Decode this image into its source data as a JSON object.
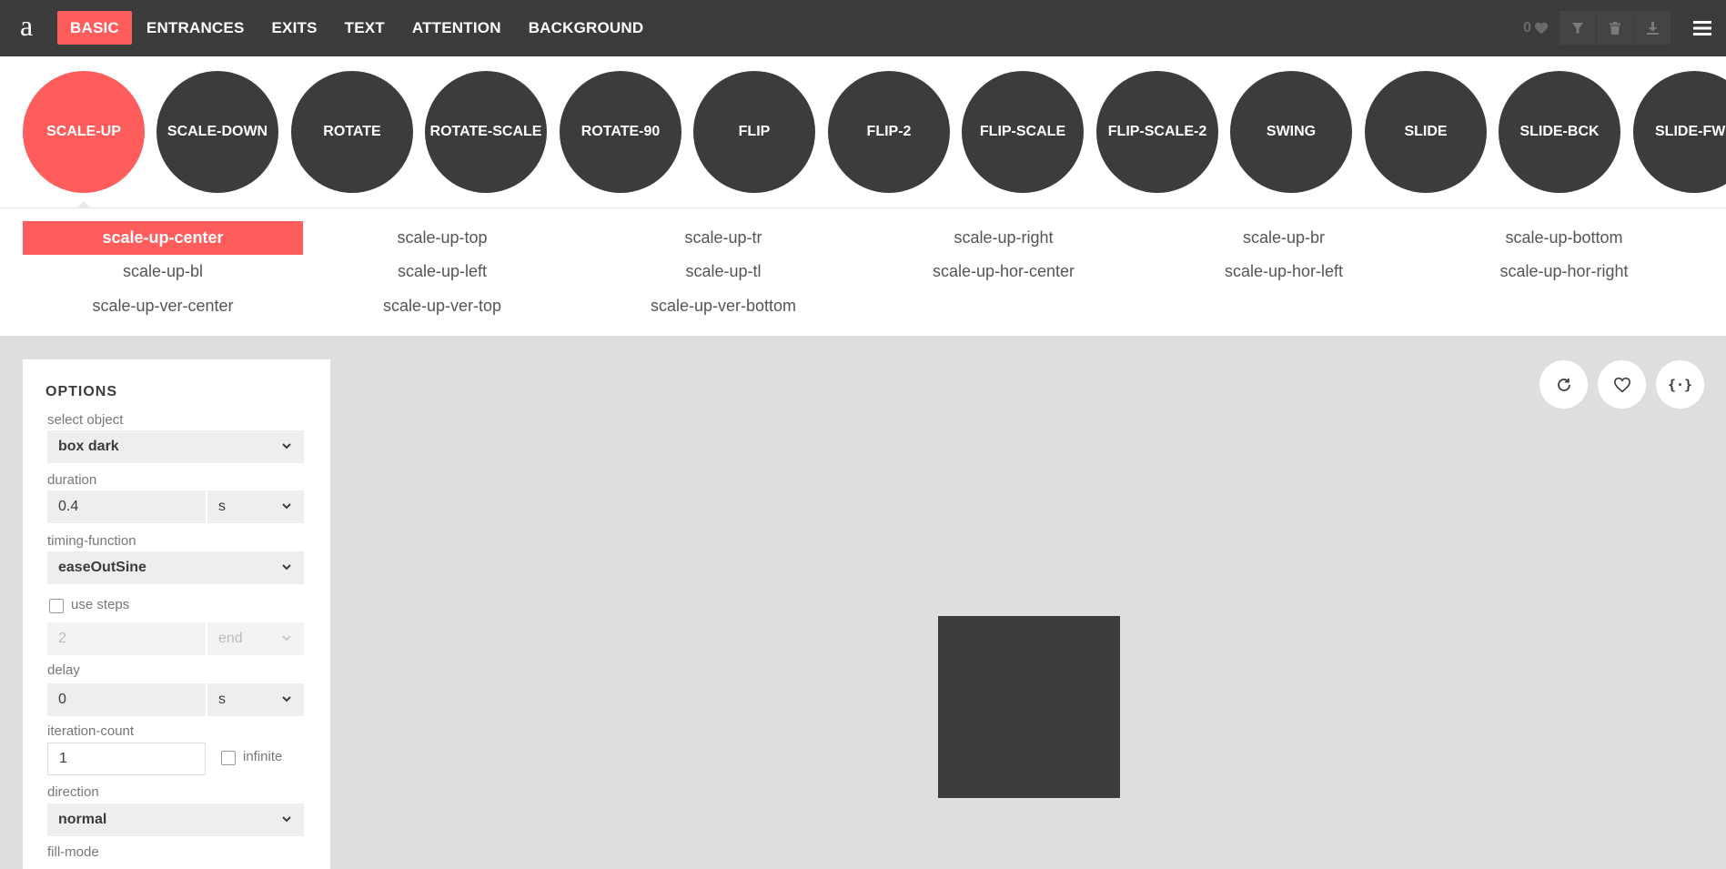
{
  "logo": "a",
  "nav": {
    "tabs": [
      "BASIC",
      "ENTRANCES",
      "EXITS",
      "TEXT",
      "ATTENTION",
      "BACKGROUND"
    ],
    "active_tab": "BASIC"
  },
  "toolbar": {
    "favorites_count": "0",
    "icons": [
      "heart-icon",
      "filter-icon",
      "trash-icon",
      "download-icon",
      "menu-icon"
    ]
  },
  "colors": {
    "accent": "#ff5c5c",
    "dark": "#3c3c3c",
    "stage": "#dedede"
  },
  "categories": [
    "SCALE-UP",
    "SCALE-DOWN",
    "ROTATE",
    "ROTATE-SCALE",
    "ROTATE-90",
    "FLIP",
    "FLIP-2",
    "FLIP-SCALE",
    "FLIP-SCALE-2",
    "SWING",
    "SLIDE",
    "SLIDE-BCK",
    "SLIDE-FWD"
  ],
  "active_category": "SCALE-UP",
  "animations": [
    "scale-up-center",
    "scale-up-top",
    "scale-up-tr",
    "scale-up-right",
    "scale-up-br",
    "scale-up-bottom",
    "scale-up-bl",
    "scale-up-left",
    "scale-up-tl",
    "scale-up-hor-center",
    "scale-up-hor-left",
    "scale-up-hor-right",
    "scale-up-ver-center",
    "scale-up-ver-top",
    "scale-up-ver-bottom"
  ],
  "active_animation": "scale-up-center",
  "options": {
    "title": "OPTIONS",
    "select_object": {
      "label": "select object",
      "value": "box dark"
    },
    "duration": {
      "label": "duration",
      "value": "0.4",
      "unit": "s"
    },
    "timing_function": {
      "label": "timing-function",
      "value": "easeOutSine"
    },
    "use_steps": {
      "label": "use steps",
      "checked": false,
      "steps": "2",
      "position": "end"
    },
    "delay": {
      "label": "delay",
      "value": "0",
      "unit": "s"
    },
    "iteration_count": {
      "label": "iteration-count",
      "value": "1",
      "infinite_label": "infinite",
      "infinite_checked": false
    },
    "direction": {
      "label": "direction",
      "value": "normal"
    },
    "fill_mode": {
      "label": "fill-mode"
    }
  },
  "stage": {
    "buttons": [
      "refresh-icon",
      "heart-icon",
      "code-icon"
    ],
    "code_glyph": "{·}"
  }
}
